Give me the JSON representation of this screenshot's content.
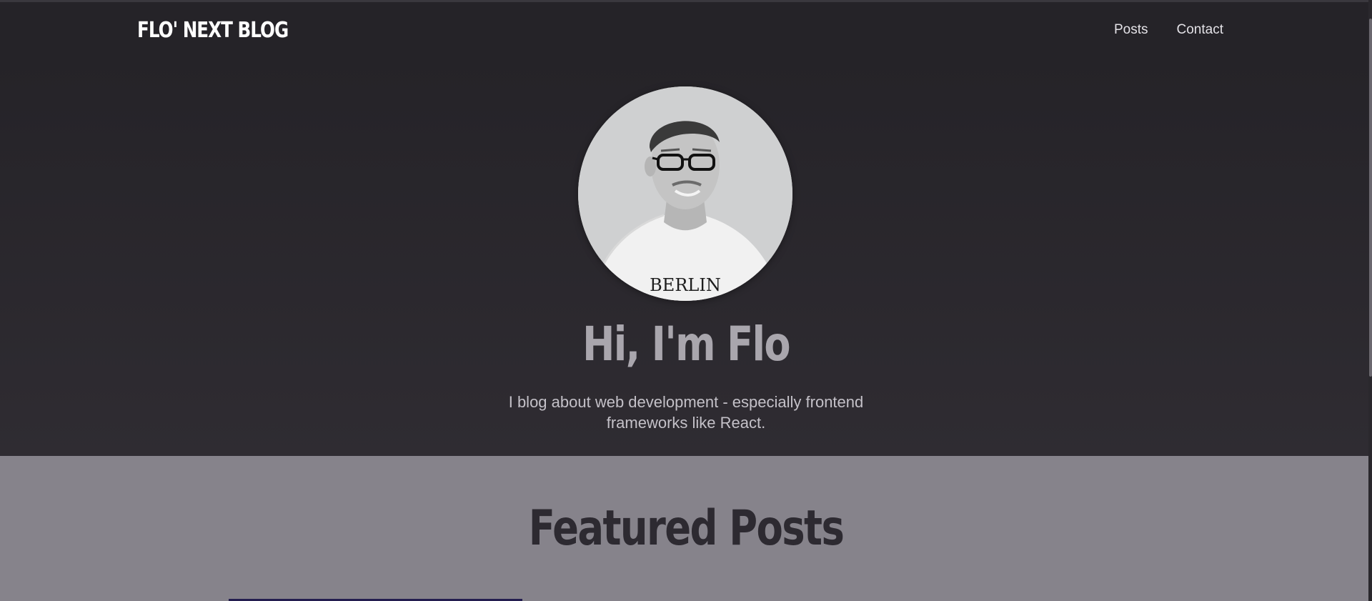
{
  "header": {
    "logo": "FLO' NEXT BLOG",
    "nav": [
      {
        "label": "Posts"
      },
      {
        "label": "Contact"
      }
    ]
  },
  "hero": {
    "title": "Hi, I'm Flo",
    "subtitle": "I blog about web development - especially frontend frameworks like React.",
    "avatar_shirt_text": "BERLIN"
  },
  "featured": {
    "title": "Featured Posts"
  },
  "colors": {
    "header_bg": "#252328",
    "hero_title": "#a9a6ad",
    "section_bg": "#86838b",
    "card_accent": "#231d4f"
  }
}
